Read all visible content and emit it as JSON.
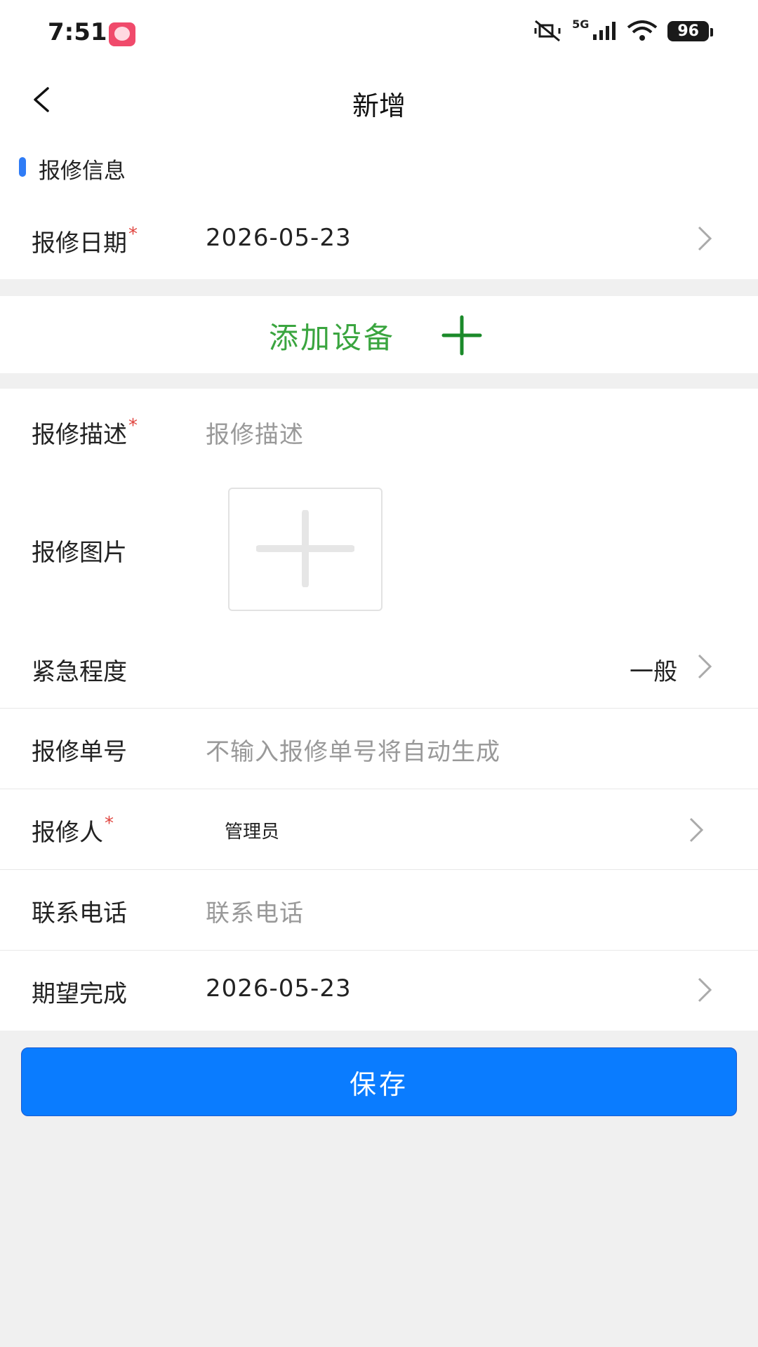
{
  "status_bar": {
    "time": "7:51",
    "network": "5G",
    "battery": "96"
  },
  "nav": {
    "title": "新增"
  },
  "section": {
    "title": "报修信息"
  },
  "form": {
    "repair_date": {
      "label": "报修日期",
      "required": "*",
      "value": "2026-05-23"
    },
    "add_equipment": {
      "label": "添加设备"
    },
    "description": {
      "label": "报修描述",
      "required": "*",
      "placeholder": "报修描述"
    },
    "photos": {
      "label": "报修图片"
    },
    "urgency": {
      "label": "紧急程度",
      "value": "一般"
    },
    "order_no": {
      "label": "报修单号",
      "placeholder": "不输入报修单号将自动生成"
    },
    "reporter": {
      "label": "报修人",
      "required": "*",
      "value": "管理员"
    },
    "phone": {
      "label": "联系电话",
      "placeholder": "联系电话"
    },
    "expected": {
      "label": "期望完成",
      "value": "2026-05-23"
    }
  },
  "actions": {
    "save": "保存"
  },
  "colors": {
    "primary": "#0a7cff",
    "accent_green": "#3aa53f",
    "required": "#e0453f",
    "section_bar": "#2f7cf6"
  }
}
